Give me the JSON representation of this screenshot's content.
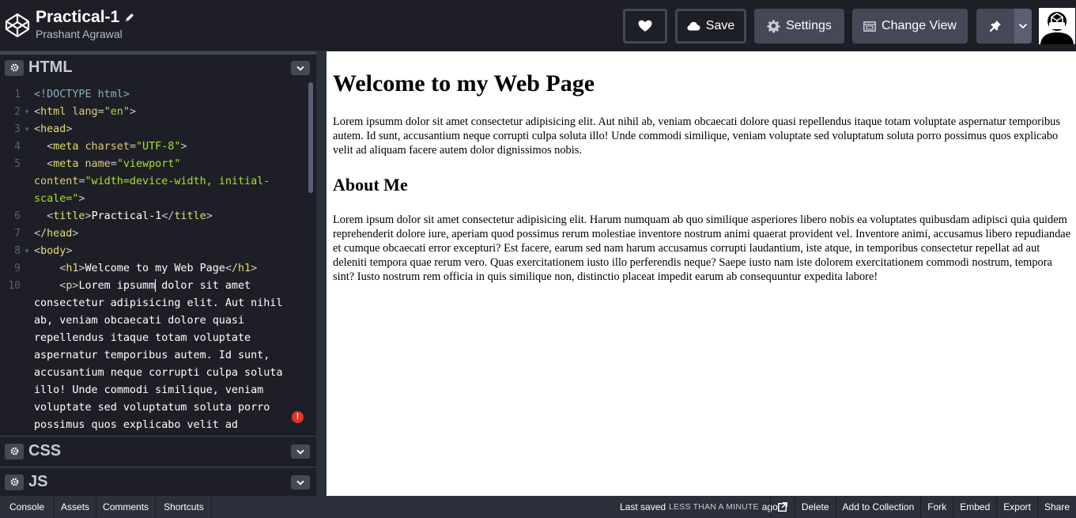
{
  "header": {
    "pen_title": "Practical-1",
    "author": "Prashant Agrawal",
    "buttons": {
      "save": "Save",
      "settings": "Settings",
      "change_view": "Change View"
    }
  },
  "editors": {
    "html": {
      "label": "HTML"
    },
    "css": {
      "label": "CSS"
    },
    "js": {
      "label": "JS"
    }
  },
  "code": {
    "line_numbers": [
      "1",
      "2",
      "3",
      "4",
      "5",
      "6",
      "7",
      "8",
      "9",
      "10"
    ],
    "l1": "<!DOCTYPE html>",
    "l2_tag": "html",
    "l2_attr": "lang",
    "l2_val": "\"en\"",
    "l3_tag": "head",
    "l4_tag": "meta",
    "l4_attr": "charset",
    "l4_val": "\"UTF-8\"",
    "l5_tag": "meta",
    "l5_attr": "name",
    "l5_val": "\"viewport\"",
    "l5b_attr": "content",
    "l5b_val": "\"width=device-width, initial-",
    "l5c_val": "scale=\"",
    "l6_tag": "title",
    "l6_text": "Practical-1",
    "l7_tag": "/head",
    "l8_tag": "body",
    "l9_tag": "h1",
    "l9_text": "Welcome to my Web Page",
    "l9_close": "/h1",
    "l10_tag": "p",
    "l10_text_a": "Lorem ipsumm",
    "l10_text_b": " dolor sit amet",
    "wrap": [
      "consectetur adipisicing elit. Aut nihil",
      "ab, veniam obcaecati dolore quasi",
      "repellendus itaque totam voluptate",
      "aspernatur temporibus autem. Id sunt,",
      "accusantium neque corrupti culpa soluta",
      "illo! Unde commodi similique, veniam",
      "voluptate sed voluptatum soluta porro",
      "possimus quos explicabo velit ad"
    ],
    "error_mark": "!"
  },
  "preview": {
    "h1": "Welcome to my Web Page",
    "p1": "Lorem ipsumm dolor sit amet consectetur adipisicing elit. Aut nihil ab, veniam obcaecati dolore quasi repellendus itaque totam voluptate aspernatur temporibus autem. Id sunt, accusantium neque corrupti culpa soluta illo! Unde commodi similique, veniam voluptate sed voluptatum soluta porro possimus quos explicabo velit ad aliquam facere autem dolor dignissimos nobis.",
    "h2": "About Me",
    "p2": "Lorem ipsum dolor sit amet consectetur adipisicing elit. Harum numquam ab quo similique asperiores libero nobis ea voluptates quibusdam adipisci quia quidem reprehenderit dolore iure, aperiam quod possimus rerum molestiae inventore nostrum animi quaerat provident vel. Inventore animi, accusamus libero repudiandae et cumque obcaecati error excepturi? Est facere, earum sed nam harum accusamus corrupti laudantium, iste atque, in temporibus consectetur repellat ad aut deleniti tempora quae rerum vero. Quas exercitationem iusto illo perferendis neque? Saepe iusto nam iste dolorem exercitationem commodi nostrum, tempora sint? Iusto nostrum rem officia in quis similique non, distinctio placeat impedit earum ab consequuntur expedita labore!"
  },
  "footer": {
    "left": [
      "Console",
      "Assets",
      "Comments",
      "Shortcuts"
    ],
    "saved_prefix": "Last saved",
    "saved_caps": "LESS THAN A MINUTE",
    "saved_suffix": "ago",
    "right": [
      "Delete",
      "Add to Collection",
      "Fork",
      "Embed",
      "Export",
      "Share"
    ]
  },
  "colors": {
    "chrome_bg": "#1e1f26",
    "editor_bg": "#1e1f26",
    "button_gray": "#444857",
    "error_red": "#e4342c"
  },
  "icons": [
    "codepen-logo-icon",
    "pencil-icon",
    "heart-icon",
    "cloud-icon",
    "gear-icon",
    "change-view-icon",
    "pin-icon",
    "chevron-down-icon",
    "external-link-icon"
  ]
}
